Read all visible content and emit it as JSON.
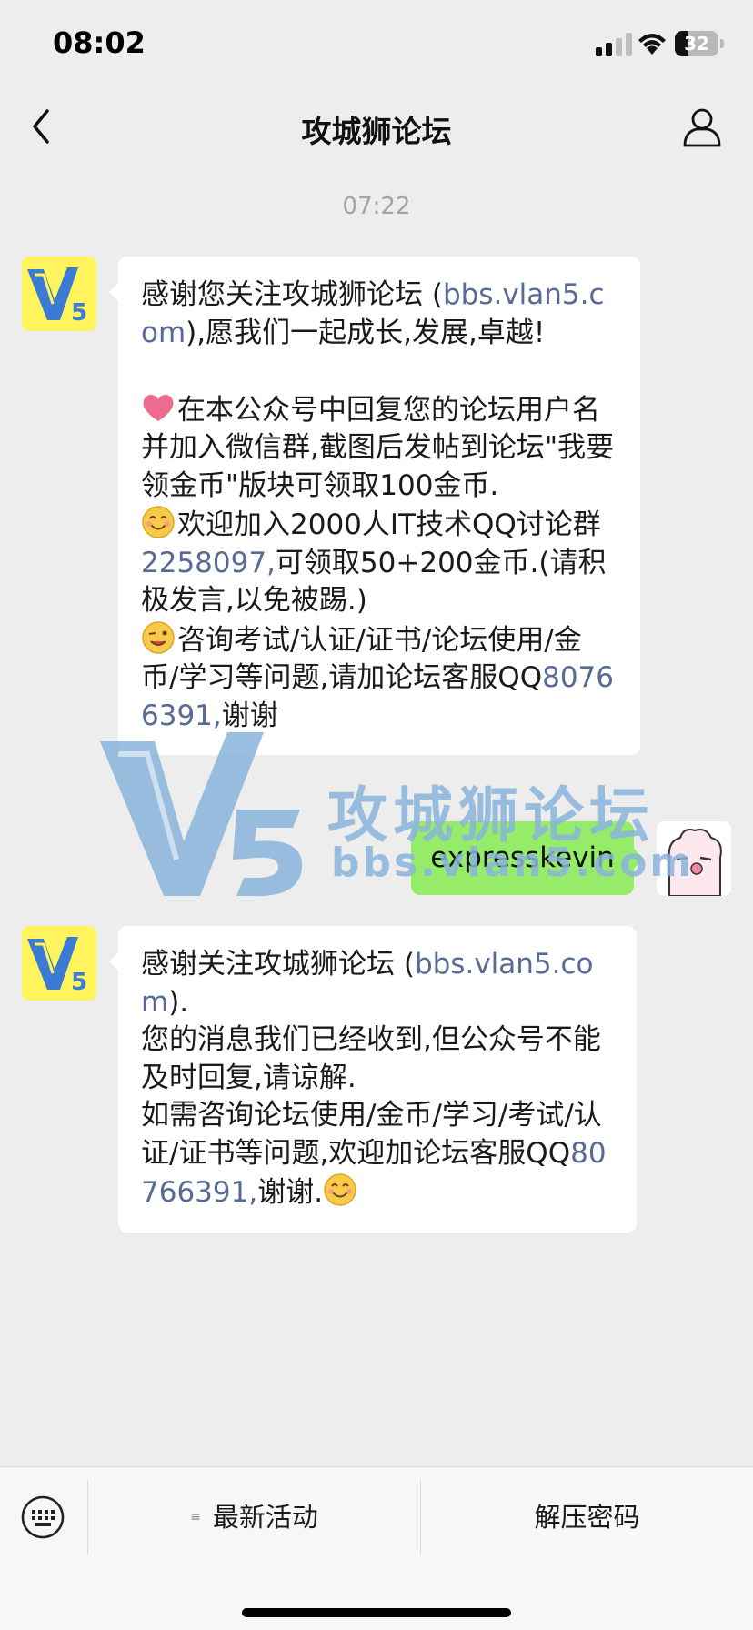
{
  "status_bar": {
    "time": "08:02",
    "battery": "32",
    "battery_level": 0.32
  },
  "nav": {
    "title": "攻城狮论坛"
  },
  "chat": {
    "timestamp": "07:22",
    "messages": [
      {
        "from": "official-account",
        "text_1": "感谢您关注攻城狮论坛 (",
        "link_1": "bbs.vlan5.com",
        "text_2": "),愿我们一起成长,发展,卓越!\n\n",
        "emoji_1": "heart-icon",
        "text_3": "在本公众号中回复您的论坛用户名并加入微信群,截图后发帖到论坛\"我要领金币\"版块可领取100金币.\n",
        "emoji_2": "smile-icon",
        "text_4": "欢迎加入2000人IT技术QQ讨论群",
        "link_2": "2258097,",
        "text_5": "可领取50+200金币.(请积极发言,以免被踢.)\n",
        "emoji_3": "wink-icon",
        "text_6": "咨询考试/认证/证书/论坛使用/金币/学习等问题,请加论坛客服QQ",
        "link_3": "80766391,",
        "text_7": "谢谢"
      },
      {
        "from": "me",
        "text": "expresskevin"
      },
      {
        "from": "official-account",
        "text_1": "感谢关注攻城狮论坛 (",
        "link_1": "bbs.vlan5.com",
        "text_2": ").\n您的消息我们已经收到,但公众号不能及时回复,请谅解.\n如需咨询论坛使用/金币/学习/考试/认证/证书等问题,欢迎加论坛客服QQ",
        "link_2": "80766391,",
        "text_3": "谢谢.",
        "emoji_1": "smile-icon"
      }
    ]
  },
  "watermark": {
    "logo": "V5",
    "title": "攻城狮论坛",
    "url": "bbs.vlan5.com"
  },
  "bottom_menu": {
    "item_1": "最新活动",
    "item_2": "解压密码"
  },
  "colors": {
    "link": "#576b95",
    "sent_bubble": "#95ec69",
    "background": "#ededed"
  }
}
